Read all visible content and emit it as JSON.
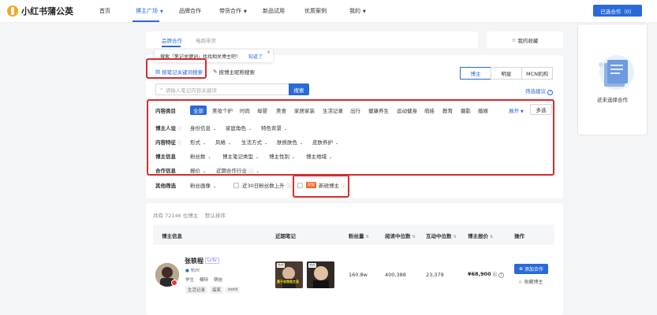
{
  "brand": {
    "name": "小红书蒲公英"
  },
  "nav": {
    "items": [
      "首页",
      "博主广场",
      "品牌合作",
      "带货合作",
      "新品试用",
      "优质案例",
      "我的"
    ],
    "selected_label": "已选合作（0）"
  },
  "tabs": {
    "brand_coop": "品牌合作",
    "ecommerce": "电商带货"
  },
  "favorites_label": "我的收藏",
  "right_card": {
    "empty_text": "还未选择合作"
  },
  "tooltip": {
    "text": "搜索「笔记关键词」找找相关博主吧！",
    "link": "知道了",
    "close": "×"
  },
  "search_mode": {
    "keyword": "按笔记关键词搜索",
    "nickname": "按博主昵称搜索"
  },
  "type_seg": [
    "博主",
    "明星",
    "MCN机构"
  ],
  "search": {
    "placeholder": "请输入笔记内容关键词",
    "button": "搜索",
    "suggest": "筛选建议"
  },
  "filters": {
    "content_category": {
      "label": "内容类目",
      "options": [
        "全部",
        "美妆个护",
        "时尚",
        "母婴",
        "美食",
        "家居家装",
        "生活记录",
        "出行",
        "健康养生",
        "运动健身",
        "萌娃",
        "教育",
        "摄影",
        "婚嫁"
      ],
      "expand": "展开",
      "multi": "多选"
    },
    "persona": {
      "label": "博主人设",
      "options": [
        "身份信息",
        "家庭角色",
        "特色背景"
      ]
    },
    "content_feature": {
      "label": "内容特征",
      "options": [
        "形式",
        "风格",
        "生活方式",
        "肤质肤色",
        "皮肤养护"
      ]
    },
    "blogger_info": {
      "label": "博主信息",
      "options": [
        "粉丝数",
        "博主笔记类型",
        "博主性别",
        "博主地域"
      ]
    },
    "coop_info": {
      "label": "合作信息",
      "options": [
        "报价",
        "近期合作行业"
      ]
    },
    "other": {
      "label": "其他筛选",
      "fan_portrait": "粉丝画像",
      "fan_growth": "近30日粉丝数上升",
      "new_badge": "新锐",
      "newbie": "新锐博主"
    }
  },
  "list": {
    "total": "共有 72146 位博主",
    "sort": "默认排序",
    "headers": [
      "博主信息",
      "近期笔记",
      "粉丝量",
      "阅读中位数",
      "互动中位数",
      "博主报价",
      "操作"
    ]
  },
  "blogger": {
    "name": "张轶程",
    "level": "Lv3v",
    "location": "杭州",
    "tags": [
      "学生",
      "模特",
      "萌娃"
    ],
    "content_tags": [
      "生活记录",
      "搞笑",
      "ootd"
    ],
    "note_tag": "合作",
    "note_caption": "黑子说我是文盲",
    "fans": "160.8w",
    "read_median": "400,388",
    "interact_median": "23,379",
    "price": "¥68,900",
    "price_suffix": "起",
    "add_btn": "添加合作",
    "fav_btn": "收藏博主"
  },
  "colors": {
    "accent": "#2a6ad8",
    "highlight_border": "#d92b2b",
    "logo": "#f5a623",
    "new_badge": "#f36b2b"
  },
  "icons": [
    "logo-icon",
    "star-icon",
    "document-search-icon",
    "nickname-icon",
    "search-icon",
    "info-icon",
    "location-pin-icon",
    "plus-icon",
    "checkbox-icon"
  ]
}
